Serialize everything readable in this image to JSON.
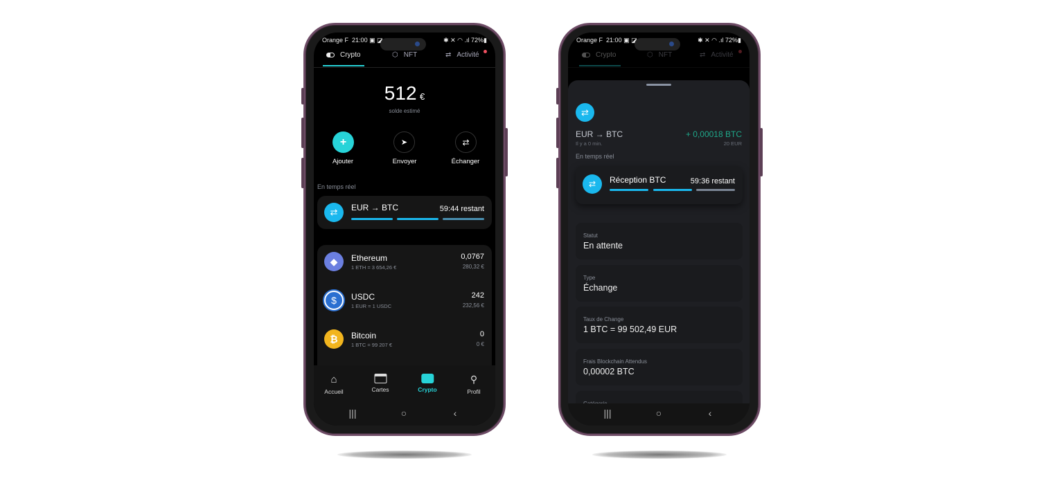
{
  "status_bar": {
    "carrier": "Orange F",
    "time": "21:00",
    "battery": "72%"
  },
  "tabs": [
    {
      "label": "Crypto",
      "icon": "toggle-icon"
    },
    {
      "label": "NFT",
      "icon": "hexagon-icon"
    },
    {
      "label": "Activité",
      "icon": "swap-arrows-icon",
      "badge": true
    }
  ],
  "balance": {
    "amount": "512",
    "currency": "€",
    "caption": "solde estimé"
  },
  "actions": [
    {
      "label": "Ajouter",
      "icon": "plus-icon"
    },
    {
      "label": "Envoyer",
      "icon": "send-icon"
    },
    {
      "label": "Échanger",
      "icon": "swap-icon"
    }
  ],
  "realtime": {
    "heading": "En temps réel",
    "title": "EUR → BTC",
    "remaining": "59:44 restant",
    "progress_segments_done": 2,
    "progress_segments_total": 3
  },
  "assets": [
    {
      "name": "Ethereum",
      "rate": "1 ETH = 3 654,26 €",
      "amount": "0,0767",
      "value": "280,32 €",
      "icon": "ethereum-icon",
      "color": "#6b7fe0"
    },
    {
      "name": "USDC",
      "rate": "1 EUR = 1 USDC",
      "amount": "242",
      "value": "232,56 €",
      "icon": "usdc-icon",
      "color": "#2a6fd1"
    },
    {
      "name": "Bitcoin",
      "rate": "1 BTC = 99 207 €",
      "amount": "0",
      "value": "0 €",
      "icon": "bitcoin-icon",
      "color": "#f2b51e"
    }
  ],
  "bottom_nav": [
    {
      "label": "Accueil",
      "icon": "home-icon"
    },
    {
      "label": "Cartes",
      "icon": "card-icon"
    },
    {
      "label": "Crypto",
      "icon": "wallet-icon",
      "active": true
    },
    {
      "label": "Profil",
      "icon": "user-icon"
    }
  ],
  "sheet": {
    "title": "EUR → BTC",
    "time_ago": "Il y a 0 min.",
    "amount": "+ 0,00018 BTC",
    "amount_eur": "20 EUR",
    "realtime_heading": "En temps réel",
    "realtime_title": "Réception BTC",
    "remaining": "59:36 restant",
    "details": [
      {
        "label": "Statut",
        "value": "En attente"
      },
      {
        "label": "Type",
        "value": "Échange"
      },
      {
        "label": "Taux de Change",
        "value": "1 BTC = 99 502,49 EUR"
      },
      {
        "label": "Frais Blockchain Attendus",
        "value": "0,00002 BTC"
      },
      {
        "label": "Catégorie",
        "value": ""
      }
    ]
  },
  "colors": {
    "accent": "#27d3d8",
    "live_blue": "#1ab8ee",
    "positive": "#1fa88a",
    "frame": "#6e4c66"
  }
}
